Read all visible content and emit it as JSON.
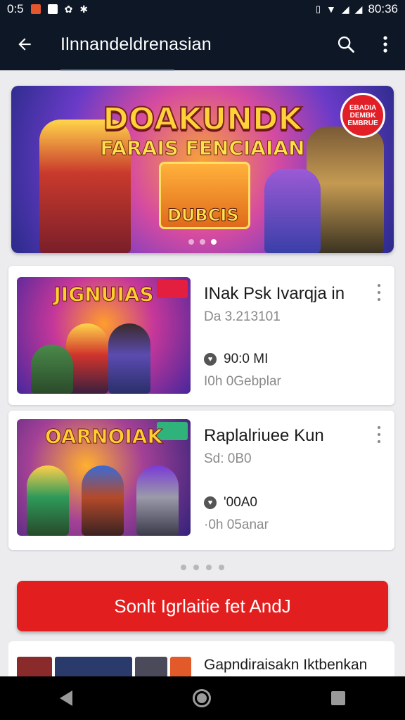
{
  "status_bar": {
    "time": "0:5",
    "right_time": "80:36"
  },
  "app_bar": {
    "title": "Ilnnandeldrenasian"
  },
  "hero": {
    "title": "DOAKUNDK",
    "subtitle": "FARAIS FENCIAIAN",
    "badge": "EBADIA DEMBK EMBRUE",
    "center_label": "DUBCIS",
    "dots": 3,
    "active_dot": 2
  },
  "items": [
    {
      "thumb_title": "JIGNUIAS",
      "name": "INak Psk Ivarqja in",
      "sub": "Da 3.213101",
      "stat": "90:0 MI",
      "stat2": "I0h 0Gebplar"
    },
    {
      "thumb_title": "OARNOIAK",
      "name": "Raplalriuee Kun",
      "sub": "Sd: 0B0",
      "stat": "'00A0",
      "stat2": "·0h 05anar"
    }
  ],
  "pager": {
    "count": 4
  },
  "cta": {
    "label": "Sonlt Igrlaitie fet AndJ"
  },
  "partial_item": {
    "name": "Gapndiraisakn Iktbenkan"
  }
}
